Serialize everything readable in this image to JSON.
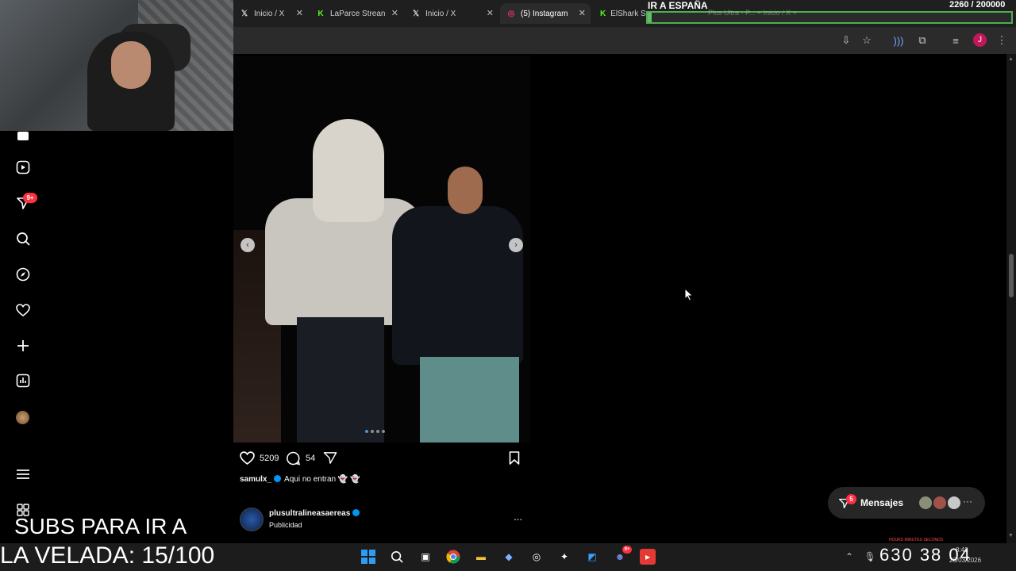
{
  "browser": {
    "tabs": [
      {
        "label": "Inicio / X",
        "icon": "x-logo-icon"
      },
      {
        "label": "LaParce Strean",
        "icon": "kick-logo-icon"
      },
      {
        "label": "Inicio / X",
        "icon": "x-logo-icon"
      },
      {
        "label": "(5) Instagram",
        "icon": "instagram-logo-icon",
        "active": true
      },
      {
        "label": "ElShark Strea",
        "icon": "kick-logo-icon"
      }
    ],
    "profile_initial": "J"
  },
  "overlay": {
    "title": "IR A ESPAÑA",
    "count": "2260  / 200000",
    "progress": 0.0113,
    "ghost_text": "Plus Ultra - P... ×     Inicio / X ×"
  },
  "nav": {
    "notifications_badge": "9+",
    "items": [
      "home-icon",
      "reels-icon",
      "messages-icon",
      "search-icon",
      "explore-icon",
      "notifications-icon",
      "create-icon",
      "dashboard-icon",
      "profile-avatar",
      "menu-icon",
      "more-apps-icon"
    ]
  },
  "post": {
    "likes": "5209",
    "comments": "54",
    "username": "samulx_",
    "caption": "Aqui no entran",
    "caption_emoji": "👻 👻"
  },
  "next_post": {
    "username": "plusultralineasaereas",
    "subtitle": "Publicidad",
    "more": "..."
  },
  "messages": {
    "label": "Mensajes",
    "badge": "5",
    "more": "···"
  },
  "stream": {
    "subs_line1": "SUBS PARA IR A",
    "subs_line2": "LA VELADA: 15/100",
    "timer": "630  38  04",
    "timer_labels": "HOURS    MINUTES    SECONDS"
  },
  "taskbar": {
    "time": "8:42",
    "date": "20/03/2026",
    "discord_badge": "9+"
  },
  "colors": {
    "accent_blue": "#0095f6",
    "badge_red": "#ff3040",
    "overlay_green": "#4caf50"
  }
}
